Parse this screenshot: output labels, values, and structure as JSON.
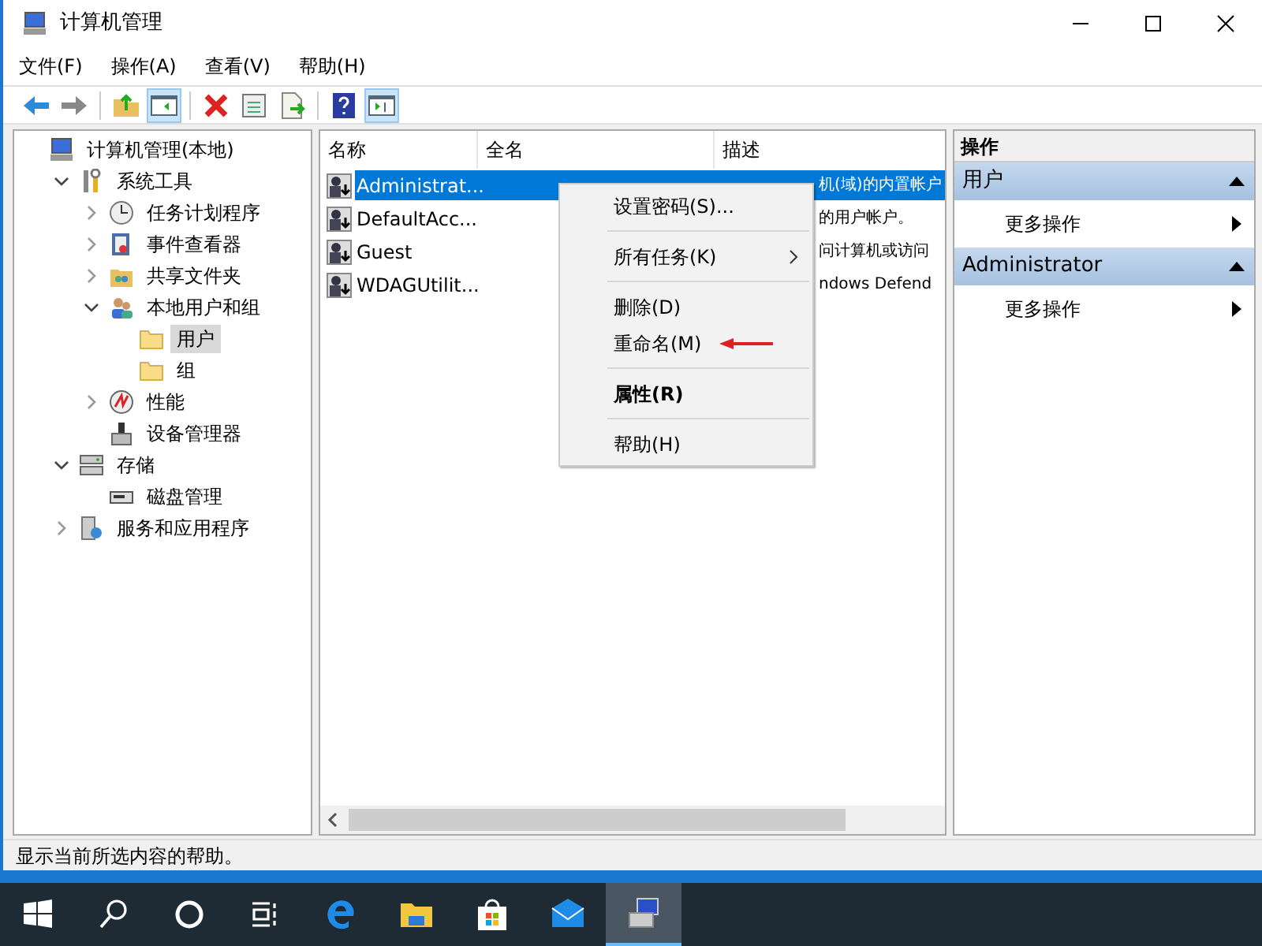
{
  "window": {
    "title": "计算机管理"
  },
  "menu": [
    "文件(F)",
    "操作(A)",
    "查看(V)",
    "帮助(H)"
  ],
  "toolbar": [
    {
      "kind": "back",
      "pressed": false
    },
    {
      "kind": "forward",
      "pressed": false
    },
    {
      "kind": "sep"
    },
    {
      "kind": "up",
      "pressed": false
    },
    {
      "kind": "tree",
      "pressed": true
    },
    {
      "kind": "sep"
    },
    {
      "kind": "delete",
      "pressed": false
    },
    {
      "kind": "properties",
      "pressed": false
    },
    {
      "kind": "export",
      "pressed": false
    },
    {
      "kind": "sep"
    },
    {
      "kind": "help",
      "pressed": false
    },
    {
      "kind": "pane",
      "pressed": true
    }
  ],
  "tree": [
    {
      "label": "计算机管理(本地)",
      "kind": "computer",
      "selected": false,
      "children": [
        {
          "label": "系统工具",
          "kind": "tools",
          "selected": false,
          "expanded": true,
          "children": [
            {
              "label": "任务计划程序",
              "kind": "clock",
              "selected": false,
              "expanded": false
            },
            {
              "label": "事件查看器",
              "kind": "log",
              "selected": false,
              "expanded": false
            },
            {
              "label": "共享文件夹",
              "kind": "share",
              "selected": false,
              "expanded": false
            },
            {
              "label": "本地用户和组",
              "kind": "users",
              "selected": false,
              "expanded": true,
              "children": [
                {
                  "label": "用户",
                  "kind": "folder",
                  "selected": true
                },
                {
                  "label": "组",
                  "kind": "folder",
                  "selected": false
                }
              ]
            },
            {
              "label": "性能",
              "kind": "perf",
              "selected": false,
              "expanded": false
            },
            {
              "label": "设备管理器",
              "kind": "device",
              "selected": false
            }
          ]
        },
        {
          "label": "存储",
          "kind": "storage",
          "selected": false,
          "expanded": true,
          "children": [
            {
              "label": "磁盘管理",
              "kind": "disk",
              "selected": false
            }
          ]
        },
        {
          "label": "服务和应用程序",
          "kind": "services",
          "selected": false,
          "expanded": false
        }
      ]
    }
  ],
  "table": {
    "columns": [
      "名称",
      "全名",
      "描述"
    ],
    "rows": [
      {
        "name": "Administrat...",
        "description": "机(域)的内置帐户",
        "selected": true
      },
      {
        "name": "DefaultAcc...",
        "description": "的用户帐户。",
        "selected": false
      },
      {
        "name": "Guest",
        "description": "问计算机或访问",
        "selected": false
      },
      {
        "name": "WDAGUtilit...",
        "description": "ndows Defend",
        "selected": false
      }
    ]
  },
  "context_menu": [
    {
      "kind": "item",
      "label": "设置密码(S)...",
      "bold": false
    },
    {
      "kind": "sep"
    },
    {
      "kind": "submenu",
      "label": "所有任务(K)",
      "bold": false
    },
    {
      "kind": "sep"
    },
    {
      "kind": "item",
      "label": "删除(D)",
      "bold": false
    },
    {
      "kind": "item",
      "label": "重命名(M)",
      "bold": false,
      "annotated": true
    },
    {
      "kind": "sep"
    },
    {
      "kind": "item",
      "label": "属性(R)",
      "bold": true
    },
    {
      "kind": "sep"
    },
    {
      "kind": "item",
      "label": "帮助(H)",
      "bold": false
    }
  ],
  "actions": {
    "title": "操作",
    "sections": [
      {
        "title": "用户",
        "expanded": true,
        "items": [
          "更多操作"
        ]
      },
      {
        "title": "Administrator",
        "expanded": true,
        "items": [
          "更多操作"
        ]
      }
    ]
  },
  "status_bar": "显示当前所选内容的帮助。",
  "taskbar": [
    {
      "kind": "start",
      "active": false
    },
    {
      "kind": "search",
      "active": false
    },
    {
      "kind": "cortana",
      "active": false
    },
    {
      "kind": "taskview",
      "active": false
    },
    {
      "kind": "edge",
      "active": false
    },
    {
      "kind": "explorer",
      "active": false
    },
    {
      "kind": "store",
      "active": false
    },
    {
      "kind": "mail",
      "active": false
    },
    {
      "kind": "mmc",
      "active": true
    }
  ]
}
